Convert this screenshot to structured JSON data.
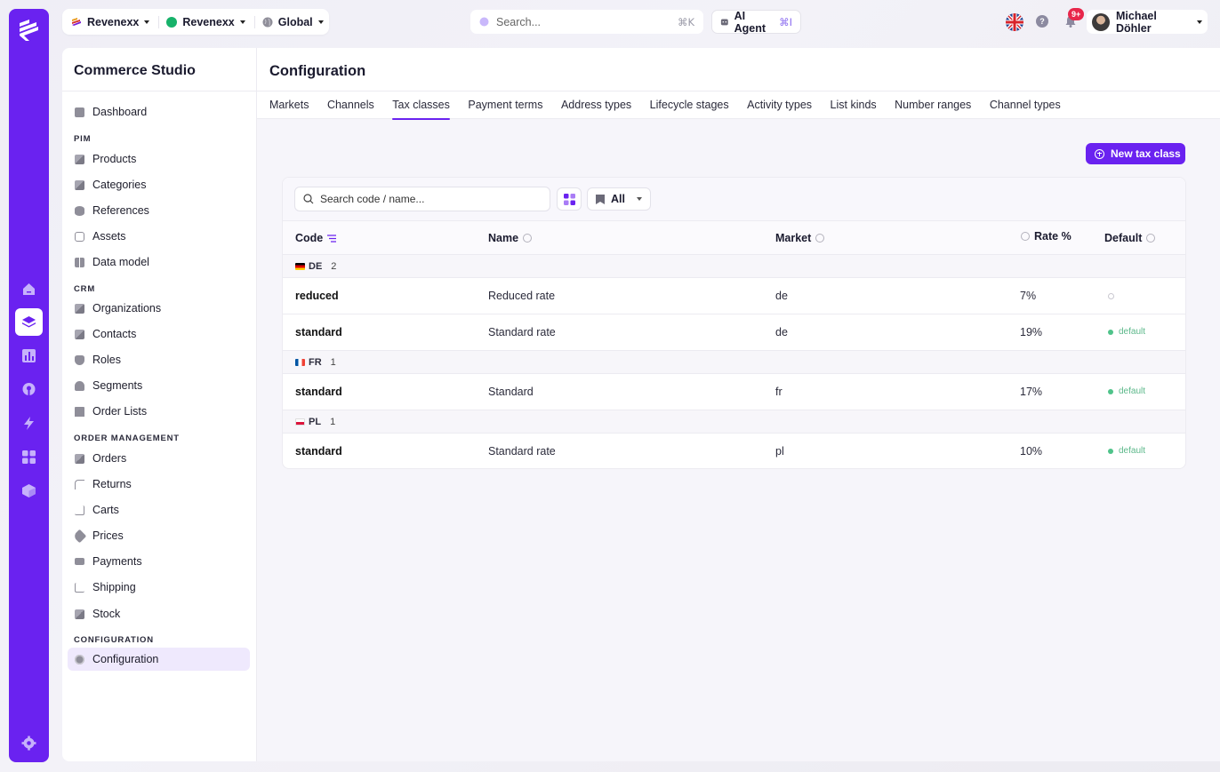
{
  "topbar": {
    "org": "Revenexx",
    "store": "Revenexx",
    "region": "Global",
    "search_placeholder": "Search...",
    "search_shortcut": "⌘K",
    "ai_agent": "AI Agent",
    "ai_shortcut": "⌘I",
    "notifications_badge": "9+",
    "user_name": "Michael Döhler"
  },
  "sidebar": {
    "title": "Commerce Studio",
    "dashboard": "Dashboard",
    "sections": {
      "pim": "PIM",
      "crm": "CRM",
      "order": "ORDER MANAGEMENT",
      "config": "CONFIGURATION"
    },
    "pim_items": [
      "Products",
      "Categories",
      "References",
      "Assets",
      "Data model"
    ],
    "crm_items": [
      "Organizations",
      "Contacts",
      "Roles",
      "Segments",
      "Order Lists"
    ],
    "order_items": [
      "Orders",
      "Returns",
      "Carts",
      "Prices",
      "Payments",
      "Shipping",
      "Stock"
    ],
    "config_items": [
      "Configuration"
    ]
  },
  "page": {
    "title": "Configuration",
    "tabs": [
      "Markets",
      "Channels",
      "Tax classes",
      "Payment terms",
      "Address types",
      "Lifecycle stages",
      "Activity types",
      "List kinds",
      "Number ranges",
      "Channel types"
    ],
    "active_tab": "Tax classes",
    "new_button": "New tax class"
  },
  "table": {
    "search_placeholder": "Search code / name...",
    "filter_value": "All",
    "columns": [
      "Code",
      "Name",
      "Market",
      "Rate %",
      "Default"
    ],
    "groups": [
      {
        "label": "DE",
        "count": "2",
        "rows": [
          {
            "code": "reduced",
            "name": "Reduced rate",
            "market": "de",
            "rate": "7%",
            "default": ""
          },
          {
            "code": "standard",
            "name": "Standard rate",
            "market": "de",
            "rate": "19%",
            "default": "default"
          }
        ]
      },
      {
        "label": "FR",
        "count": "1",
        "rows": [
          {
            "code": "standard",
            "name": "Standard",
            "market": "fr",
            "rate": "17%",
            "default": "default"
          }
        ]
      },
      {
        "label": "PL",
        "count": "1",
        "rows": [
          {
            "code": "standard",
            "name": "Standard rate",
            "market": "pl",
            "rate": "10%",
            "default": "default"
          }
        ]
      }
    ]
  },
  "colors": {
    "accent": "#6a22f0",
    "default_green": "#4fc38a"
  }
}
